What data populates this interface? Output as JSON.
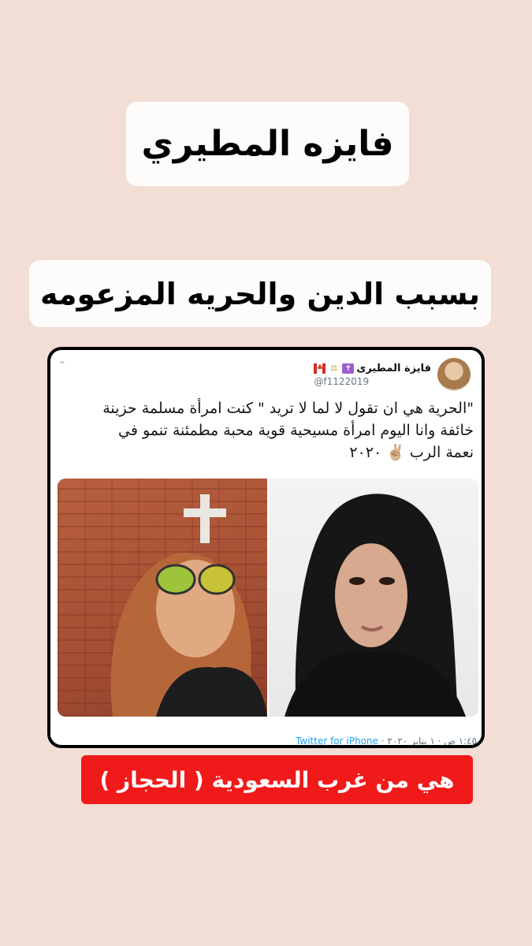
{
  "story": {
    "title": "فايزه المطيري",
    "subtitle": "بسبب الدين والحريه المزعومه",
    "banner": "هي من غرب السعودية ( الحجاز )"
  },
  "tweet": {
    "display_name": "فايزة المطيرى",
    "handle": "@f1122019",
    "emojis": [
      "cross-emoji",
      "scales-emoji",
      "canada-flag-emoji"
    ],
    "text_lines": [
      "\"الحرية هي ان تقول لا لما لا تريد \" كنت امرأة مسلمة حزينة",
      "خائفة وانا اليوم امرأة مسيحية قوية محبة مطمئنة تنمو في",
      "نعمة الرب ✌🏼 ٢٠٢٠"
    ],
    "timestamp": "١:٤٥ ص · ١ يناير ٢٠٢٠",
    "source": "Twitter for iPhone"
  },
  "colors": {
    "background": "#f2ded4",
    "banner": "#f11a1a",
    "twitter_blue": "#1da1f2"
  }
}
